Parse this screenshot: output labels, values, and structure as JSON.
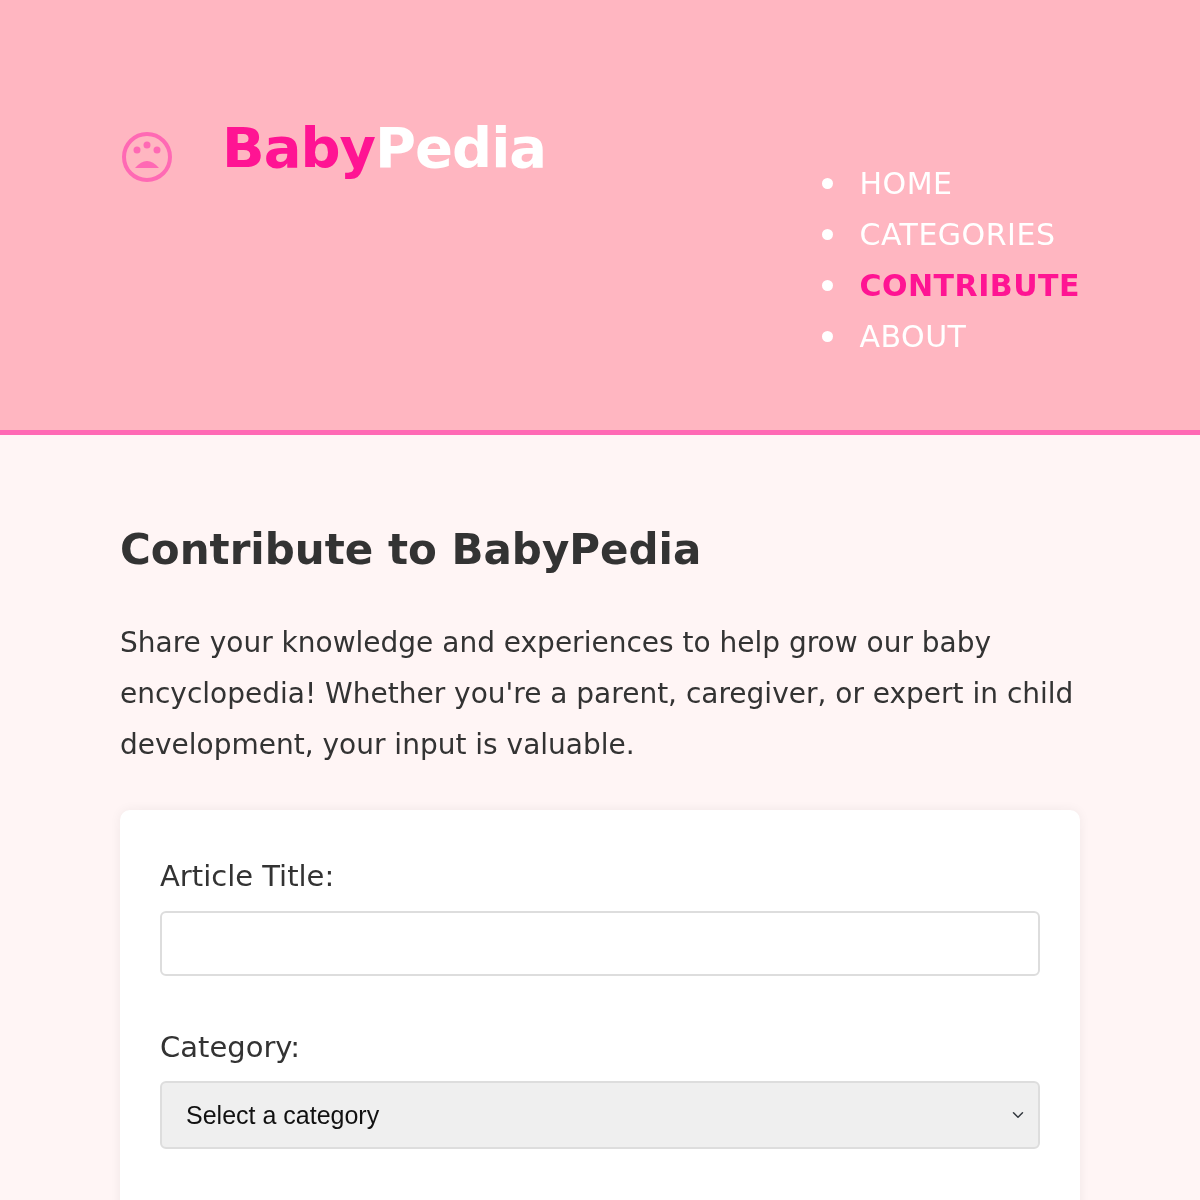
{
  "logo": {
    "first": "Baby",
    "second": "Pedia"
  },
  "nav": [
    {
      "label": "HOME",
      "selected": false
    },
    {
      "label": "CATEGORIES",
      "selected": false
    },
    {
      "label": "CONTRIBUTE",
      "selected": true
    },
    {
      "label": "ABOUT",
      "selected": false
    }
  ],
  "heading": "Contribute to BabyPedia",
  "intro": "Share your knowledge and experiences to help grow our baby encyclopedia! Whether you're a parent, caregiver, or expert in child development, your input is valuable.",
  "form": {
    "fields": [
      {
        "kind": "text",
        "label": "Article Title:"
      },
      {
        "kind": "select",
        "label": "Category:",
        "value": "Select a category"
      }
    ]
  }
}
